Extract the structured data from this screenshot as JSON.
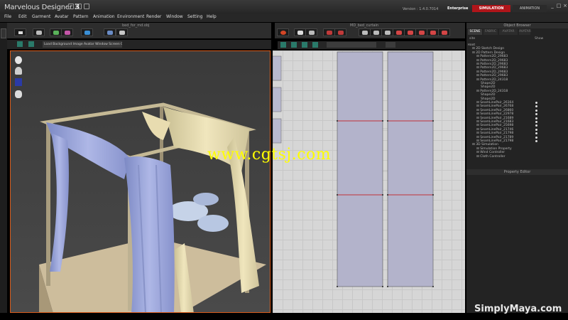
{
  "app": {
    "name_prefix": "Marvelous",
    "name_main": " Designer",
    "version_number": "3",
    "version_text": "Version : 1.4.0.7014",
    "edition": "Enterprise",
    "modes": [
      "SIMULATION",
      "ANIMATION"
    ]
  },
  "menu": [
    "File",
    "Edit",
    "Garment",
    "Avatar",
    "Pattern",
    "Animation",
    "Environment",
    "Render",
    "Window",
    "Setting",
    "Help"
  ],
  "panels": {
    "view3d_title": "bed_for_md.obj",
    "view2d_title": "MD_bed_curtain",
    "view3d_menu": "Load Background Image  Avatar  Window  Screen Capture"
  },
  "object_browser": {
    "title": "Object Browser",
    "tabs": [
      "SCENE",
      "FABRIC",
      "AVATAR",
      "AVATAR"
    ],
    "header_name": "site",
    "header_show": "Show",
    "tree": [
      {
        "label": "Root",
        "indent": 0,
        "show": false
      },
      {
        "label": "2D Sketch Design",
        "indent": 1,
        "show": false
      },
      {
        "label": "2D Pattern Design",
        "indent": 1,
        "show": false
      },
      {
        "label": "Pattern2D_29683",
        "indent": 2,
        "show": false
      },
      {
        "label": "Pattern2D_29683",
        "indent": 2,
        "show": false
      },
      {
        "label": "Pattern2D_29683",
        "indent": 2,
        "show": false
      },
      {
        "label": "Pattern2D_29683",
        "indent": 2,
        "show": false
      },
      {
        "label": "Pattern2D_29683",
        "indent": 2,
        "show": false
      },
      {
        "label": "Pattern2D_29683",
        "indent": 2,
        "show": false
      },
      {
        "label": "Pattern2D_24318",
        "indent": 2,
        "show": false
      },
      {
        "label": "Shape2D",
        "indent": 3,
        "show": false
      },
      {
        "label": "Shape2D",
        "indent": 3,
        "show": false
      },
      {
        "label": "Pattern2D_24318",
        "indent": 2,
        "show": false
      },
      {
        "label": "Shape2D",
        "indent": 3,
        "show": false
      },
      {
        "label": "Shape2D",
        "indent": 3,
        "show": false
      },
      {
        "label": "SeamLinePair_26164",
        "indent": 2,
        "show": true
      },
      {
        "label": "SeamLinePair_26768",
        "indent": 2,
        "show": true
      },
      {
        "label": "SeamLinePair_26860",
        "indent": 2,
        "show": true
      },
      {
        "label": "SeamLinePair_22978",
        "indent": 2,
        "show": true
      },
      {
        "label": "SeamLinePair_21689",
        "indent": 2,
        "show": true
      },
      {
        "label": "SeamLinePair_21683",
        "indent": 2,
        "show": true
      },
      {
        "label": "SeamLinePair_25698",
        "indent": 2,
        "show": true
      },
      {
        "label": "SeamLinePair_21746",
        "indent": 2,
        "show": true
      },
      {
        "label": "SeamLinePair_21798",
        "indent": 2,
        "show": true
      },
      {
        "label": "SeamLinePair_21789",
        "indent": 2,
        "show": true
      },
      {
        "label": "SeamLinePair_21798",
        "indent": 2,
        "show": true
      },
      {
        "label": "3D Simulation",
        "indent": 1,
        "show": false
      },
      {
        "label": "Simulation Property",
        "indent": 2,
        "show": false
      },
      {
        "label": "Wind Controller",
        "indent": 2,
        "show": false
      },
      {
        "label": "Cloth Controller",
        "indent": 2,
        "show": false
      }
    ]
  },
  "property_editor": {
    "title": "Property Editor"
  },
  "watermarks": {
    "cgtsj": "www.cgtsj.com",
    "simplymaya": "SimplyMaya.com"
  },
  "colors": {
    "accent": "#b0151a",
    "viewport_border": "#d85b1a",
    "seam": "#c0303a",
    "watermark": "#ffff00"
  }
}
